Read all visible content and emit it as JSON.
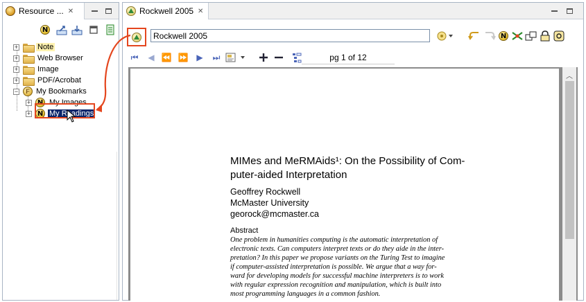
{
  "left_view": {
    "tab_title": "Resource ...",
    "tree": [
      {
        "label": "Note",
        "type": "folder"
      },
      {
        "label": "Web Browser",
        "type": "folder"
      },
      {
        "label": "Image",
        "type": "folder"
      },
      {
        "label": "PDF/Acrobat",
        "type": "folder"
      },
      {
        "label": "My Bookmarks",
        "type": "bookmarks-root"
      },
      {
        "label": "My Images",
        "type": "n-node"
      },
      {
        "label": "My Readings",
        "type": "n-node",
        "selected": true
      }
    ]
  },
  "editor": {
    "tab_title": "Rockwell 2005",
    "address_value": "Rockwell 2005",
    "page_indicator": "pg 1 of 12"
  },
  "document": {
    "title_line1": "MIMes and MeRMAids¹: On the Possibility of Com-",
    "title_line2": "puter-aided Interpretation",
    "author": "Geoffrey Rockwell",
    "affiliation": "McMaster University",
    "email": "georock@mcmaster.ca",
    "abstract_heading": "Abstract",
    "abstract_lines": [
      "One problem in humanities computing is the automatic interpretation of",
      "electronic texts. Can computers interpret texts or do they aide in the inter-",
      "pretation? In this paper we propose variants on the Turing Test to imagine",
      "if computer-assisted interpretation is possible. We argue that a way for-",
      "ward for developing models for successful machine interpreters is to work",
      "with regular expression recognition and manipulation, which is built into",
      "most programming languages in a common fashion."
    ]
  },
  "colors": {
    "annotation": "#e4461e",
    "selection": "#0a246a",
    "nav_blue": "#4a64b8",
    "doc_background": "#8b8b8b"
  },
  "icons": {
    "close": "close-icon",
    "minimize": "minimize-icon",
    "maximize": "maximize-icon",
    "folder": "folder-icon",
    "n_node": "n-node-icon",
    "pdf_resource": "pdf-resource-icon"
  }
}
